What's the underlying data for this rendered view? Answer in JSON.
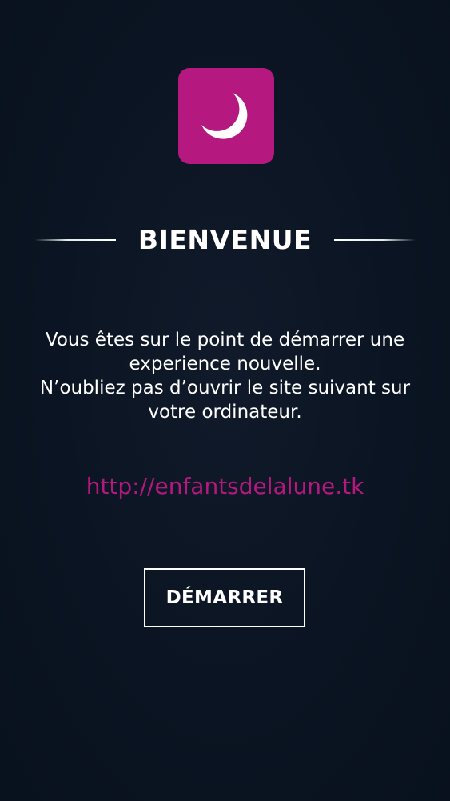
{
  "app_icon": {
    "icon": "crescent-moon-icon",
    "background_color": "#b5187f"
  },
  "header": {
    "title": "BIENVENUE"
  },
  "message": {
    "lines": [
      "Vous êtes sur le point de démarrer une",
      "experience nouvelle.",
      "N’oubliez pas d’ouvrir le site suivant sur",
      "votre ordinateur."
    ]
  },
  "site": {
    "url": "http://enfantsdelalune.tk",
    "color": "#b5187f"
  },
  "actions": {
    "start_label": "DÉMARRER"
  },
  "colors": {
    "background": "#0b1422",
    "accent": "#b5187f",
    "text": "#ffffff"
  }
}
